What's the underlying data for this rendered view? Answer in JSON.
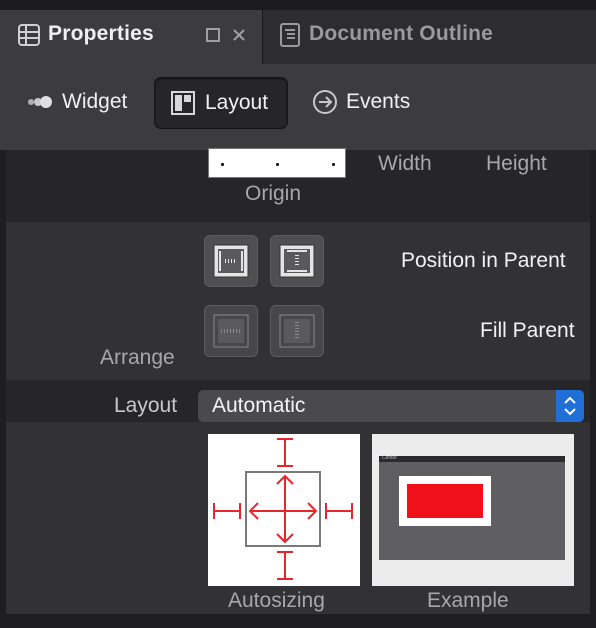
{
  "tabs": [
    {
      "label": "Properties",
      "icon": "properties-icon",
      "active": true
    },
    {
      "label": "Document Outline",
      "icon": "document-outline-icon",
      "active": false
    }
  ],
  "toolbar": {
    "items": [
      {
        "label": "Widget",
        "icon": "widget-icon",
        "selected": false
      },
      {
        "label": "Layout",
        "icon": "layout-icon",
        "selected": true
      },
      {
        "label": "Events",
        "icon": "events-icon",
        "selected": false
      }
    ]
  },
  "size_section": {
    "origin_label": "Origin",
    "width_label": "Width",
    "height_label": "Height"
  },
  "arrange": {
    "label": "Arrange",
    "position_label": "Position in Parent",
    "fill_label": "Fill Parent"
  },
  "layout": {
    "label": "Layout",
    "value": "Automatic"
  },
  "previews": {
    "autosizing_label": "Autosizing",
    "example_label": "Example",
    "example_window_title": "Center"
  },
  "colors": {
    "accent": "#1f6fd6",
    "autosize_red": "#e8252a",
    "example_red": "#f0101a"
  }
}
